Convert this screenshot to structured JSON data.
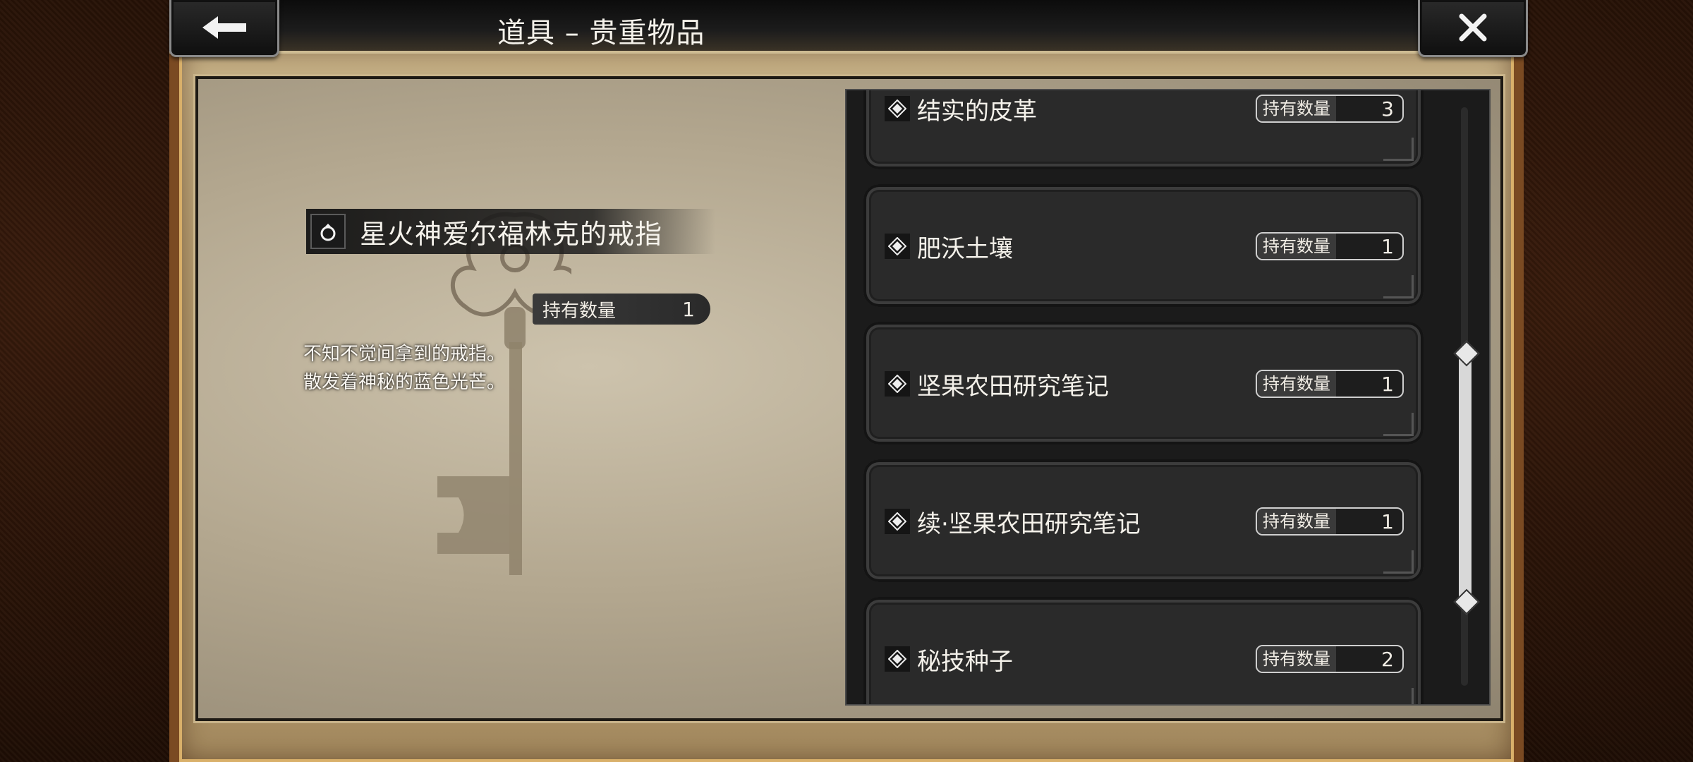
{
  "header": {
    "title": "道具 – 贵重物品",
    "back_icon": "arrow-left-icon",
    "close_icon": "close-x-icon"
  },
  "selected_item": {
    "name": "星火神爱尔福林克的戒指",
    "icon": "ring-icon",
    "count_label": "持有数量",
    "count": "1",
    "description_line1": "不知不觉间拿到的戒指。",
    "description_line2": "散发着神秘的蓝色光芒。"
  },
  "items": [
    {
      "name": "结实的皮革",
      "count_label": "持有数量",
      "count": "3"
    },
    {
      "name": "肥沃土壤",
      "count_label": "持有数量",
      "count": "1"
    },
    {
      "name": "坚果农田研究笔记",
      "count_label": "持有数量",
      "count": "1"
    },
    {
      "name": "续·坚果农田研究笔记",
      "count_label": "持有数量",
      "count": "1"
    },
    {
      "name": "秘技种子",
      "count_label": "持有数量",
      "count": "2"
    }
  ],
  "scroll_position": 0.45,
  "colors": {
    "leather": "#2a1409",
    "parchment": "#b3a78f",
    "list_bg": "#1b1b1b",
    "item_bg": "#2a2a2a",
    "gold_trim": "#d9b06a"
  }
}
